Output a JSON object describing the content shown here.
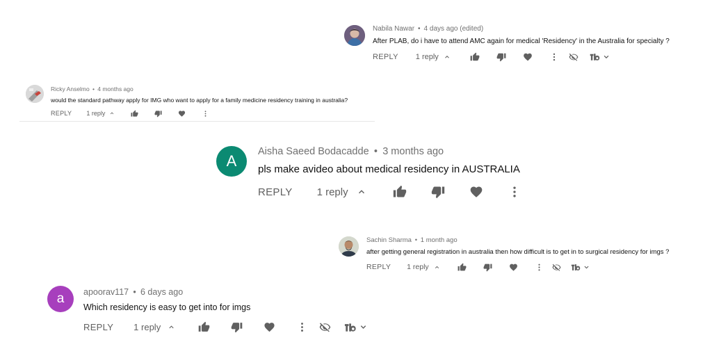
{
  "comments": {
    "nabila": {
      "author": "Nabila Nawar",
      "time": "4 days ago (edited)",
      "text": "After PLAB, do i have to attend AMC again for medical 'Residency' in the Australia for specialty ?",
      "reply_label": "REPLY",
      "replies": "1 reply"
    },
    "ricky": {
      "author": "Ricky Anselmo",
      "time": "4 months ago",
      "text": "would the standard pathway apply for IMG who want to apply for a family medicine residency training in australia?",
      "reply_label": "REPLY",
      "replies": "1 reply"
    },
    "aisha": {
      "author": "Aisha Saeed Bodacadde",
      "time": "3 months ago",
      "text": "pls make avideo about medical residency in AUSTRALIA",
      "reply_label": "REPLY",
      "replies": "1 reply",
      "avatar_letter": "A",
      "avatar_color": "#0b8a72"
    },
    "sachin": {
      "author": "Sachin Sharma",
      "time": "1 month ago",
      "text": "after getting general registration in australia then how difficult is to get in to surgical residency for imgs ?",
      "reply_label": "REPLY",
      "replies": "1 reply"
    },
    "apoorav": {
      "author": "apoorav117",
      "time": "6 days ago",
      "text": "Which residency is easy to get into for imgs",
      "reply_label": "REPLY",
      "replies": "1 reply",
      "avatar_letter": "a",
      "avatar_color": "#a73fbd"
    }
  },
  "icons": {
    "expand": "caret-up-icon",
    "like": "thumbs-up-icon",
    "dislike": "thumbs-down-icon",
    "heart": "heart-icon",
    "more": "vertical-ellipsis-icon",
    "hide": "eye-slash-icon",
    "extension": "tubebuddy-logo-icon",
    "dropdown": "chevron-down-icon"
  },
  "colors": {
    "meta_text": "#707070",
    "action_icons": "#606060",
    "divider": "#e6e6e6"
  }
}
